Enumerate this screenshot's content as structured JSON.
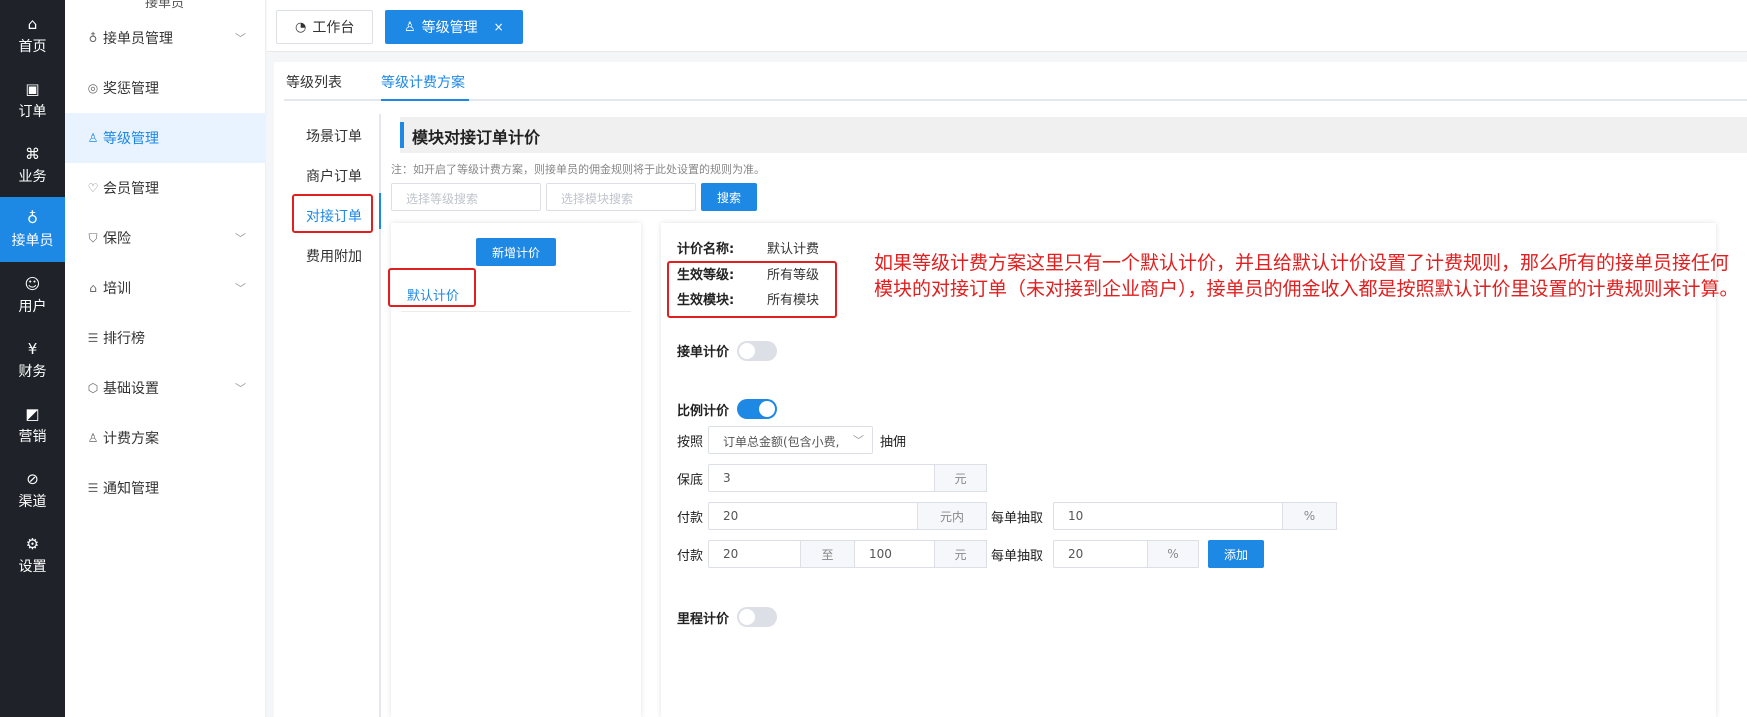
{
  "rail": {
    "items": [
      {
        "label": "首页",
        "icon": "home-icon"
      },
      {
        "label": "订单",
        "icon": "order-icon"
      },
      {
        "label": "业务",
        "icon": "apps-icon"
      },
      {
        "label": "接单员",
        "icon": "bike-icon"
      },
      {
        "label": "用户",
        "icon": "user-icon"
      },
      {
        "label": "财务",
        "icon": "yen-icon"
      },
      {
        "label": "营销",
        "icon": "chart-icon"
      },
      {
        "label": "渠道",
        "icon": "compass-icon"
      },
      {
        "label": "设置",
        "icon": "gear-icon"
      }
    ],
    "active_color": "#1e88e5"
  },
  "sidebar": {
    "caption": "接单员",
    "items": [
      {
        "label": "接单员管理",
        "icon": "bike-icon",
        "expandable": true
      },
      {
        "label": "奖惩管理",
        "icon": "medal-icon",
        "expandable": false
      },
      {
        "label": "等级管理",
        "icon": "users-icon",
        "expandable": false
      },
      {
        "label": "会员管理",
        "icon": "vip-icon",
        "expandable": false
      },
      {
        "label": "保险",
        "icon": "shield-icon",
        "expandable": true
      },
      {
        "label": "培训",
        "icon": "school-icon",
        "expandable": true
      },
      {
        "label": "排行榜",
        "icon": "list-icon",
        "expandable": false
      },
      {
        "label": "基础设置",
        "icon": "hexagon-icon",
        "expandable": true
      },
      {
        "label": "计费方案",
        "icon": "users-icon",
        "expandable": false
      },
      {
        "label": "通知管理",
        "icon": "list-icon",
        "expandable": false
      }
    ]
  },
  "topbar": {
    "tabs": [
      {
        "label": "工作台",
        "icon": "dashboard-icon"
      },
      {
        "label": "等级管理",
        "icon": "users-icon",
        "close": "×"
      }
    ]
  },
  "subtabs": [
    "等级列表",
    "等级计费方案"
  ],
  "vnav": [
    "场景订单",
    "商户订单",
    "对接订单",
    "费用附加"
  ],
  "section_title": "模块对接订单计价",
  "note": "注：如开启了等级计费方案，则接单员的佣金规则将于此处设置的规则为准。",
  "search": {
    "level_placeholder": "选择等级搜索",
    "module_placeholder": "选择模块搜索",
    "button": "搜索"
  },
  "left_card": {
    "add_button": "新增计价",
    "items": [
      "默认计价"
    ]
  },
  "detail": {
    "name_label": "计价名称:",
    "name_value": "默认计费",
    "level_label": "生效等级:",
    "level_value": "所有等级",
    "module_label": "生效模块:",
    "module_value": "所有模块",
    "order_pricing_label": "接单计价",
    "order_pricing_on": false,
    "ratio_pricing_label": "比例计价",
    "ratio_pricing_on": true,
    "by_label": "按照",
    "by_select": "订单总金额(包含小费,",
    "commission_label": "抽佣",
    "floor_label": "保底",
    "floor_value": "3",
    "unit_yuan": "元",
    "pay_label": "付款",
    "pay1_value": "20",
    "unit_within": "元内",
    "each_label": "每单抽取",
    "each1_value": "10",
    "unit_percent": "%",
    "pay2_from": "20",
    "to_label": "至",
    "pay2_to": "100",
    "each2_value": "20",
    "add_button": "添加",
    "mileage_pricing_label": "里程计价",
    "mileage_pricing_on": false
  },
  "annotation": "如果等级计费方案这里只有一个默认计价，并且给默认计价设置了计费规则，那么所有的接单员接任何模块的对接订单（未对接到企业商户），接单员的佣金收入都是按照默认计价里设置的计费规则来计算。",
  "colors": {
    "primary": "#1e88e5",
    "annotation": "#e02020",
    "rail_bg": "#1f2329"
  }
}
